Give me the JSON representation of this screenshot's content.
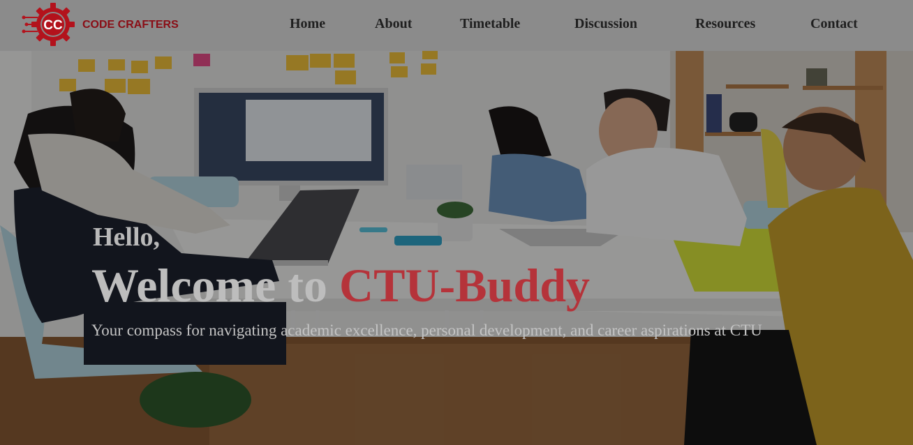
{
  "brand": {
    "logo_text": "CODE CRAFTERS",
    "logo_monogram": "CC",
    "logo_icon": "gear-circuit-icon",
    "color": "#b3121c"
  },
  "nav": {
    "items": [
      {
        "label": "Home"
      },
      {
        "label": "About"
      },
      {
        "label": "Timetable"
      },
      {
        "label": "Discussion"
      },
      {
        "label": "Resources"
      },
      {
        "label": "Contact"
      }
    ]
  },
  "hero": {
    "greeting": "Hello,",
    "welcome_prefix": "Welcome to ",
    "welcome_brand": "CTU-Buddy",
    "subtitle": "Your compass for navigating academic excellence, personal development, and career aspirations at CTU",
    "accent_color": "#b5333a"
  }
}
